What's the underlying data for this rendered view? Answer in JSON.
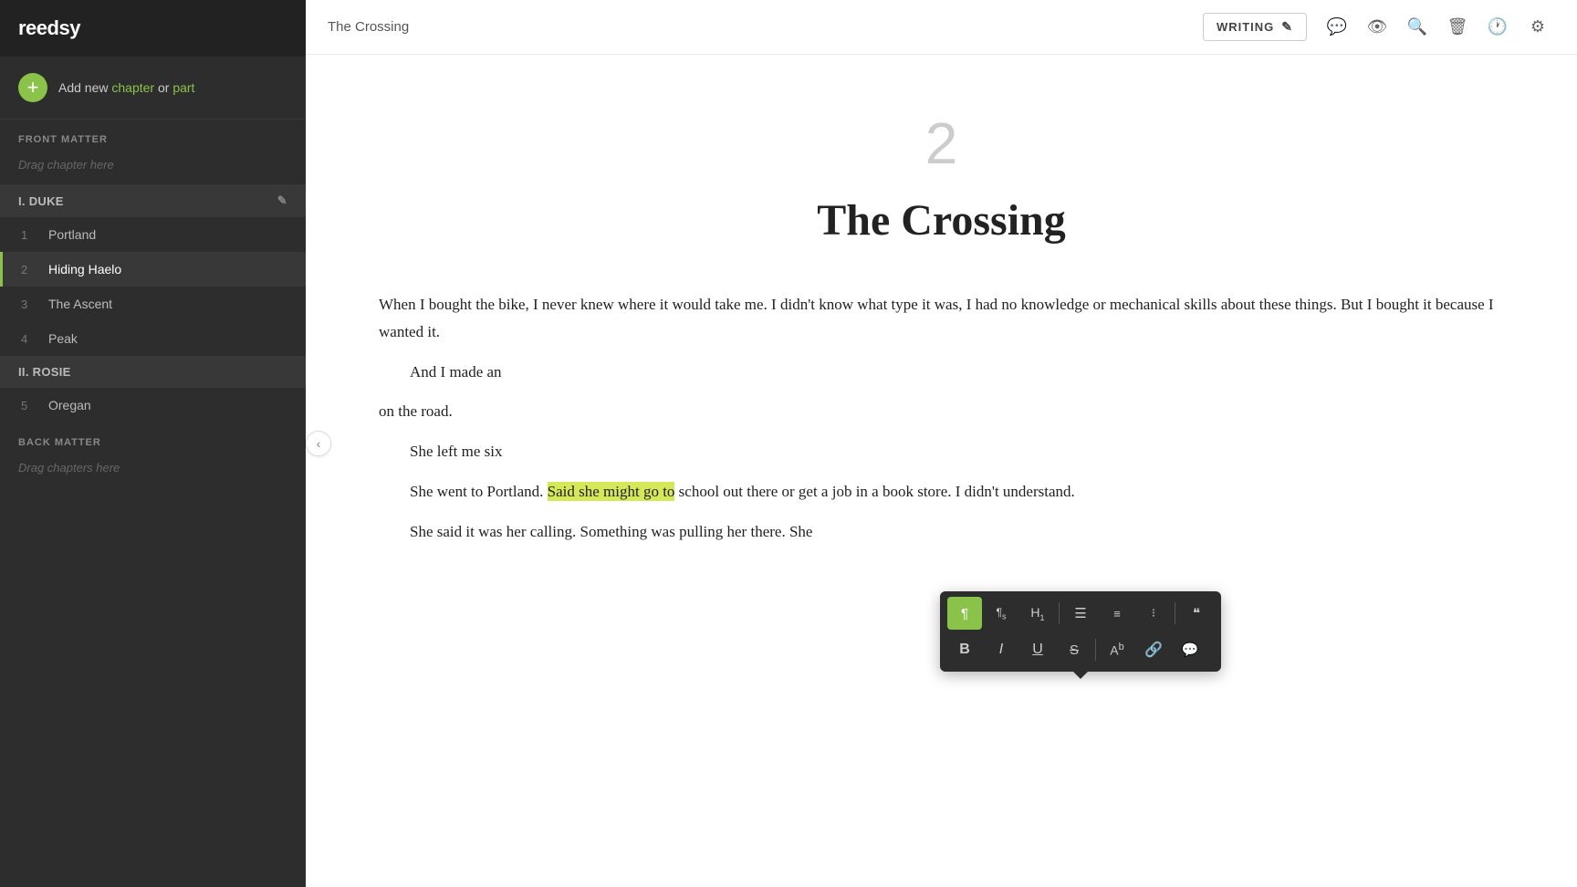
{
  "logo": "reedsy",
  "add_new": {
    "text_prefix": "Add new ",
    "chapter_link": "chapter",
    "text_or": " or ",
    "part_link": "part"
  },
  "sidebar": {
    "front_matter_label": "FRONT MATTER",
    "front_matter_drag": "Drag chapter here",
    "parts": [
      {
        "id": "I",
        "label": "I. DUKE",
        "chapters": [
          {
            "num": "1",
            "name": "Portland",
            "active": false
          },
          {
            "num": "2",
            "name": "Hiding Haelo",
            "active": true
          },
          {
            "num": "3",
            "name": "The Ascent",
            "active": false
          },
          {
            "num": "4",
            "name": "Peak",
            "active": false
          }
        ]
      },
      {
        "id": "II",
        "label": "II. ROSIE",
        "chapters": [
          {
            "num": "5",
            "name": "Oregan",
            "active": false
          }
        ]
      }
    ],
    "back_matter_label": "BACK MATTER",
    "back_matter_drag": "Drag chapters here"
  },
  "header": {
    "chapter_title": "The Crossing",
    "writing_mode": "WRITING",
    "icons": {
      "pencil": "✏",
      "comment": "💬",
      "eye": "👁",
      "search": "🔍",
      "trash": "🗑",
      "history": "🕐",
      "settings": "⚙"
    }
  },
  "content": {
    "chapter_number": "2",
    "chapter_heading": "The Crossing",
    "paragraphs": [
      {
        "indent": false,
        "text": "When I bought the bike, I never knew where it would take me. I didn't know what type it was, I had no knowledge or mechanical skills about these things. But I bought it because I wanted it."
      },
      {
        "indent": true,
        "text": "And I made an"
      },
      {
        "indent": false,
        "text": "on the road."
      },
      {
        "indent": true,
        "text": "She left me six"
      },
      {
        "indent": true,
        "text_before_highlight": "She went to Portland. ",
        "highlight": "Said she might go to",
        "text_after_highlight": " school out there or get a job in a book store. I didn't understand."
      },
      {
        "indent": true,
        "text": "She said it was her calling. Something was pulling her there. She"
      }
    ]
  },
  "floating_toolbar": {
    "row1_buttons": [
      {
        "label": "¶",
        "title": "paragraph",
        "active_yellow": true
      },
      {
        "label": "¶s",
        "title": "paragraph-sans",
        "active": false
      },
      {
        "label": "H₁",
        "title": "heading-1",
        "active": false
      },
      {
        "label": "≡",
        "title": "align",
        "active": false
      },
      {
        "label": "≡#",
        "title": "ordered-list",
        "active": false
      },
      {
        "label": "≡•",
        "title": "unordered-list",
        "active": false
      },
      {
        "label": "❝",
        "title": "blockquote",
        "active": false
      }
    ],
    "row2_buttons": [
      {
        "label": "B",
        "title": "bold",
        "active": false
      },
      {
        "label": "I",
        "title": "italic",
        "active": false
      },
      {
        "label": "U",
        "title": "underline",
        "active": false
      },
      {
        "label": "S",
        "title": "strikethrough",
        "active": false
      },
      {
        "label": "Aᵇ",
        "title": "font-size",
        "active": false
      },
      {
        "label": "🔗",
        "title": "link",
        "active": false
      },
      {
        "label": "💬",
        "title": "comment",
        "active": false
      }
    ]
  }
}
